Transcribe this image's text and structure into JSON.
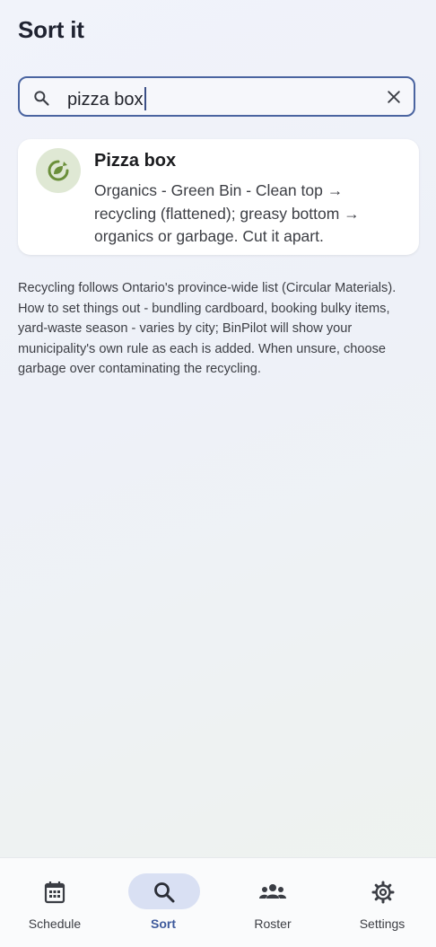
{
  "header": {
    "title": "Sort it"
  },
  "search": {
    "value": "pizza box",
    "search_icon": "search-icon",
    "clear_icon": "close-icon"
  },
  "result": {
    "icon": "compost-icon",
    "name": "Pizza box",
    "description": "Organics - Green Bin - Clean top → recycling (flattened); greasy bottom → organics or garbage. Cut it apart."
  },
  "note": "Recycling follows Ontario's province-wide list (Circular Materials). How to set things out - bundling cardboard, booking bulky items, yard-waste season - varies by city; BinPilot will show your municipality's own rule as each is added. When unsure, choose garbage over contaminating the recycling.",
  "nav": {
    "items": [
      {
        "label": "Schedule",
        "icon": "calendar-icon"
      },
      {
        "label": "Sort",
        "icon": "search-icon",
        "active": true
      },
      {
        "label": "Roster",
        "icon": "group-icon"
      },
      {
        "label": "Settings",
        "icon": "gear-icon"
      }
    ]
  },
  "colors": {
    "accent": "#4a64a0",
    "active_pill": "#d9e0f3",
    "badge_bg": "#dfe8d4",
    "badge_icon": "#6b8f3a"
  }
}
